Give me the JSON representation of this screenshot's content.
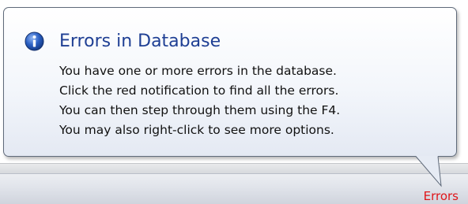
{
  "balloon": {
    "icon": "info-icon",
    "title": "Errors in Database",
    "lines": [
      "You have one or more errors in the database.",
      "Click the red notification to find all the errors.",
      "You can then step through them using the F4.",
      "You may also right-click to see more options."
    ]
  },
  "statusbar": {
    "errors_label": "Errors"
  },
  "colors": {
    "title": "#1f3f94",
    "errors": "#e0161a",
    "icon_blue": "#2a5fc3"
  }
}
